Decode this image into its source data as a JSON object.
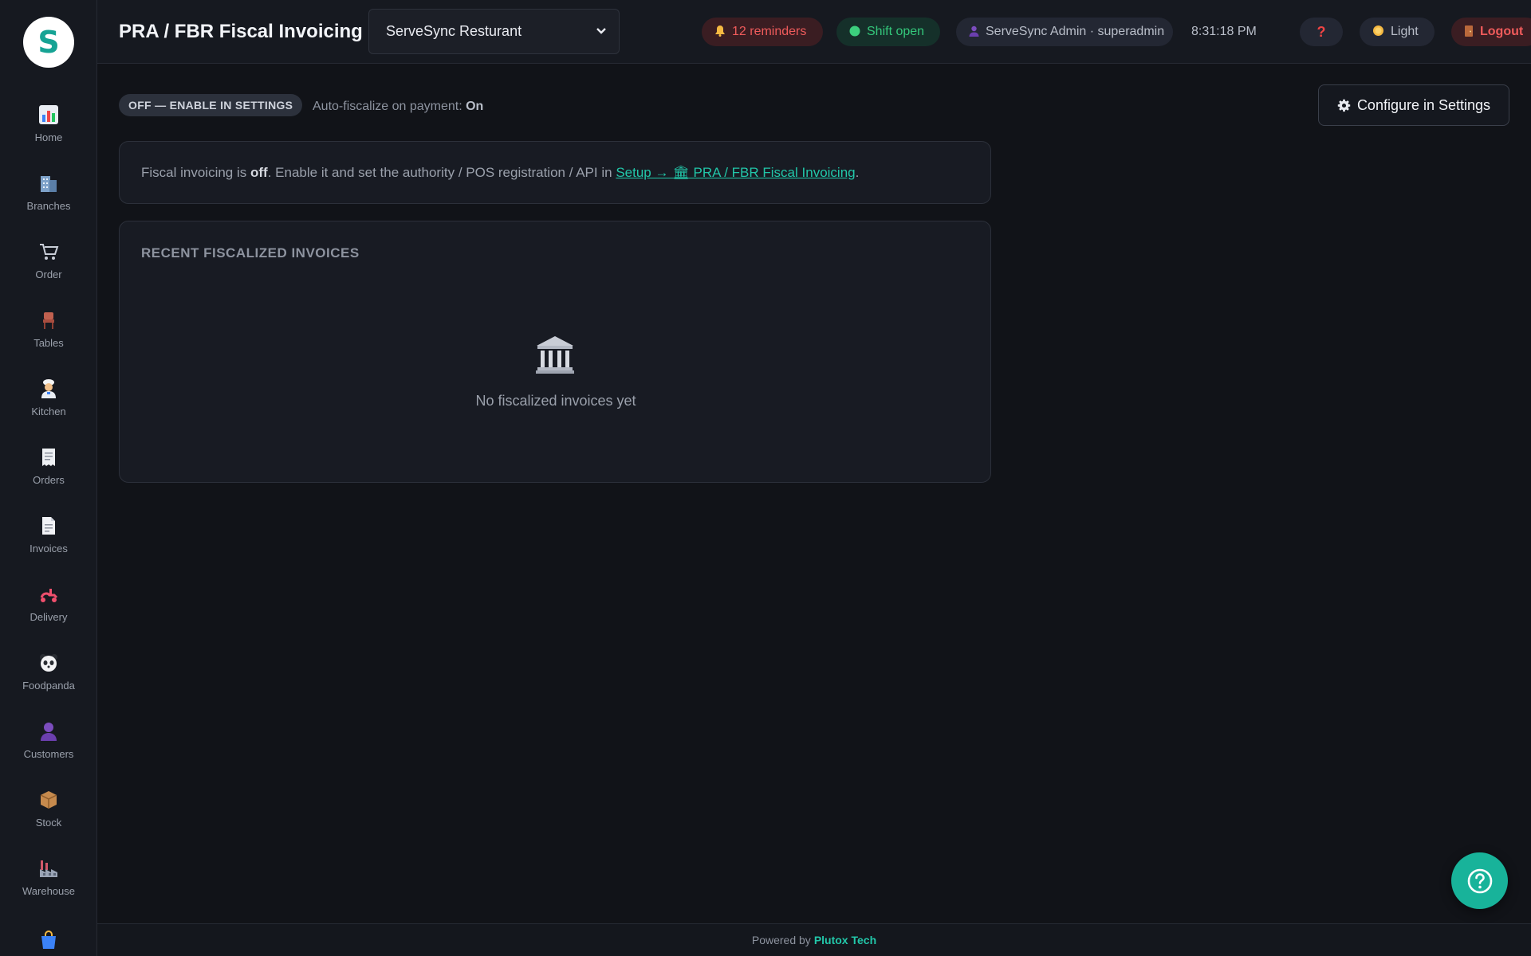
{
  "app": {
    "logo_letter": "S",
    "page_title": "PRA / FBR Fiscal Invoicing"
  },
  "branch_select": {
    "value": "ServeSync Resturant"
  },
  "topbar": {
    "reminders": "12 reminders",
    "shift": "Shift open",
    "user": "ServeSync Admin · superadmin",
    "clock": "8:31:18 PM",
    "help": "?",
    "theme": "Light",
    "logout": "Logout"
  },
  "sidebar": {
    "items": [
      {
        "label": "Home",
        "icon": "chart-icon"
      },
      {
        "label": "Branches",
        "icon": "building-icon"
      },
      {
        "label": "Order",
        "icon": "cart-icon"
      },
      {
        "label": "Tables",
        "icon": "chair-icon"
      },
      {
        "label": "Kitchen",
        "icon": "chef-icon"
      },
      {
        "label": "Orders",
        "icon": "receipt-icon"
      },
      {
        "label": "Invoices",
        "icon": "document-icon"
      },
      {
        "label": "Delivery",
        "icon": "scooter-icon"
      },
      {
        "label": "Foodpanda",
        "icon": "panda-icon"
      },
      {
        "label": "Customers",
        "icon": "person-icon"
      },
      {
        "label": "Stock",
        "icon": "package-icon"
      },
      {
        "label": "Warehouse",
        "icon": "factory-icon"
      }
    ]
  },
  "main": {
    "status_badge": "OFF — ENABLE IN SETTINGS",
    "autofiscalize_label": "Auto-fiscalize on payment:",
    "autofiscalize_value": "On",
    "configure_button": "Configure in Settings",
    "info": {
      "prefix": "Fiscal invoicing is",
      "state": "off",
      "middle": ". Enable it and set the authority / POS registration / API in",
      "link": "Setup → 🏛 PRA / FBR Fiscal Invoicing",
      "suffix": "."
    },
    "recent": {
      "heading": "RECENT FISCALIZED INVOICES",
      "empty_text": "No fiscalized invoices yet"
    }
  },
  "footer": {
    "powered_by": "Powered by",
    "brand": "Plutox Tech"
  },
  "colors": {
    "background": "#111318",
    "panel": "#181b23",
    "accent": "#22c7a9",
    "danger": "#ef5b5b",
    "success": "#34c77b"
  }
}
